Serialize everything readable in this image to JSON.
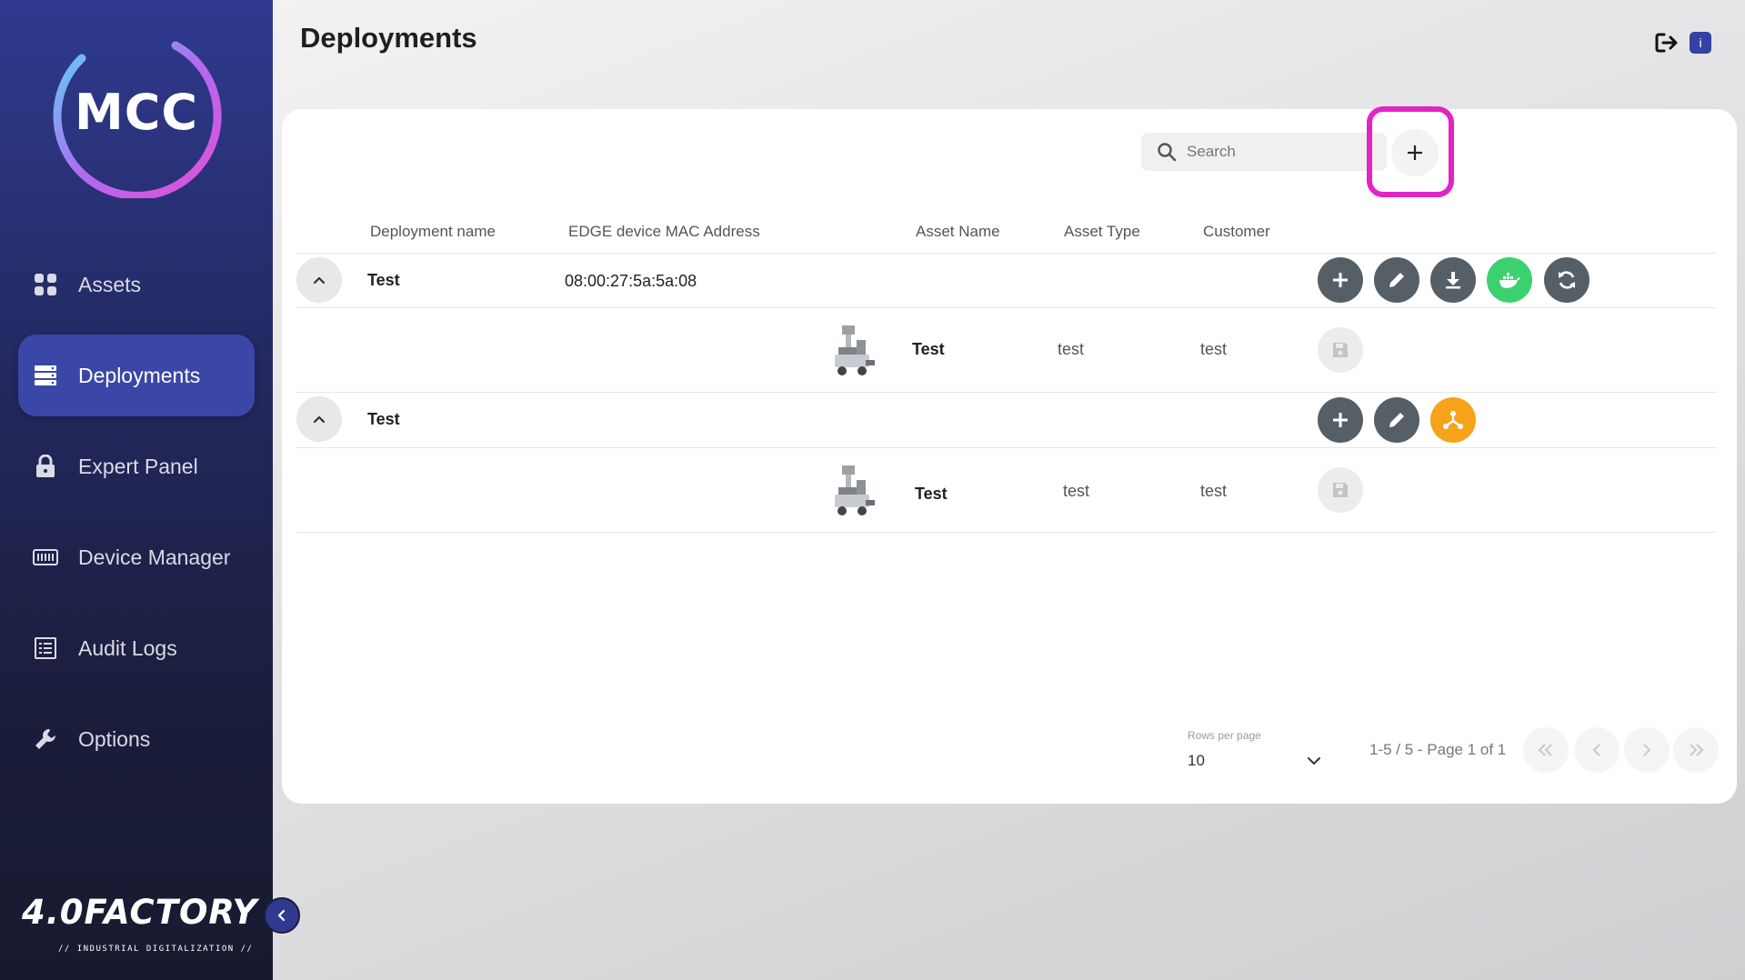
{
  "app": {
    "logo_text": "MCC",
    "brand_name": "4.0FACTORY",
    "brand_tagline": "// INDUSTRIAL DIGITALIZATION //"
  },
  "sidebar": {
    "items": [
      {
        "label": "Assets",
        "icon": "grid-icon",
        "active": false
      },
      {
        "label": "Deployments",
        "icon": "server-list-icon",
        "active": true
      },
      {
        "label": "Expert Panel",
        "icon": "lock-icon",
        "active": false
      },
      {
        "label": "Device Manager",
        "icon": "keyboard-icon",
        "active": false
      },
      {
        "label": "Audit Logs",
        "icon": "list-document-icon",
        "active": false
      },
      {
        "label": "Options",
        "icon": "wrench-icon",
        "active": false
      }
    ]
  },
  "header": {
    "title": "Deployments",
    "info_badge": "i"
  },
  "toolbar": {
    "search_placeholder": "Search",
    "add_label": "+"
  },
  "table": {
    "columns": [
      "Deployment name",
      "EDGE device MAC Address",
      "Asset Name",
      "Asset Type",
      "Customer"
    ],
    "rows": [
      {
        "deployment_name": "Test",
        "mac_address": "08:00:27:5a:5a:08",
        "actions": [
          "add",
          "edit",
          "download",
          "docker",
          "sync"
        ],
        "asset": {
          "name": "Test",
          "type": "test",
          "customer": "test"
        }
      },
      {
        "deployment_name": "Test",
        "mac_address": "",
        "actions": [
          "add",
          "edit",
          "network"
        ],
        "asset": {
          "name": "Test",
          "type": "test",
          "customer": "test"
        }
      }
    ]
  },
  "pagination": {
    "rows_per_page_label": "Rows per page",
    "rows_per_page": "10",
    "info": "1-5 / 5 - Page 1 of 1"
  },
  "colors": {
    "sidebar_active": "#3a47a6",
    "highlight": "#e324c4",
    "docker_green": "#3bd16f",
    "network_orange": "#f7a21b",
    "action_dark": "#565f66"
  }
}
